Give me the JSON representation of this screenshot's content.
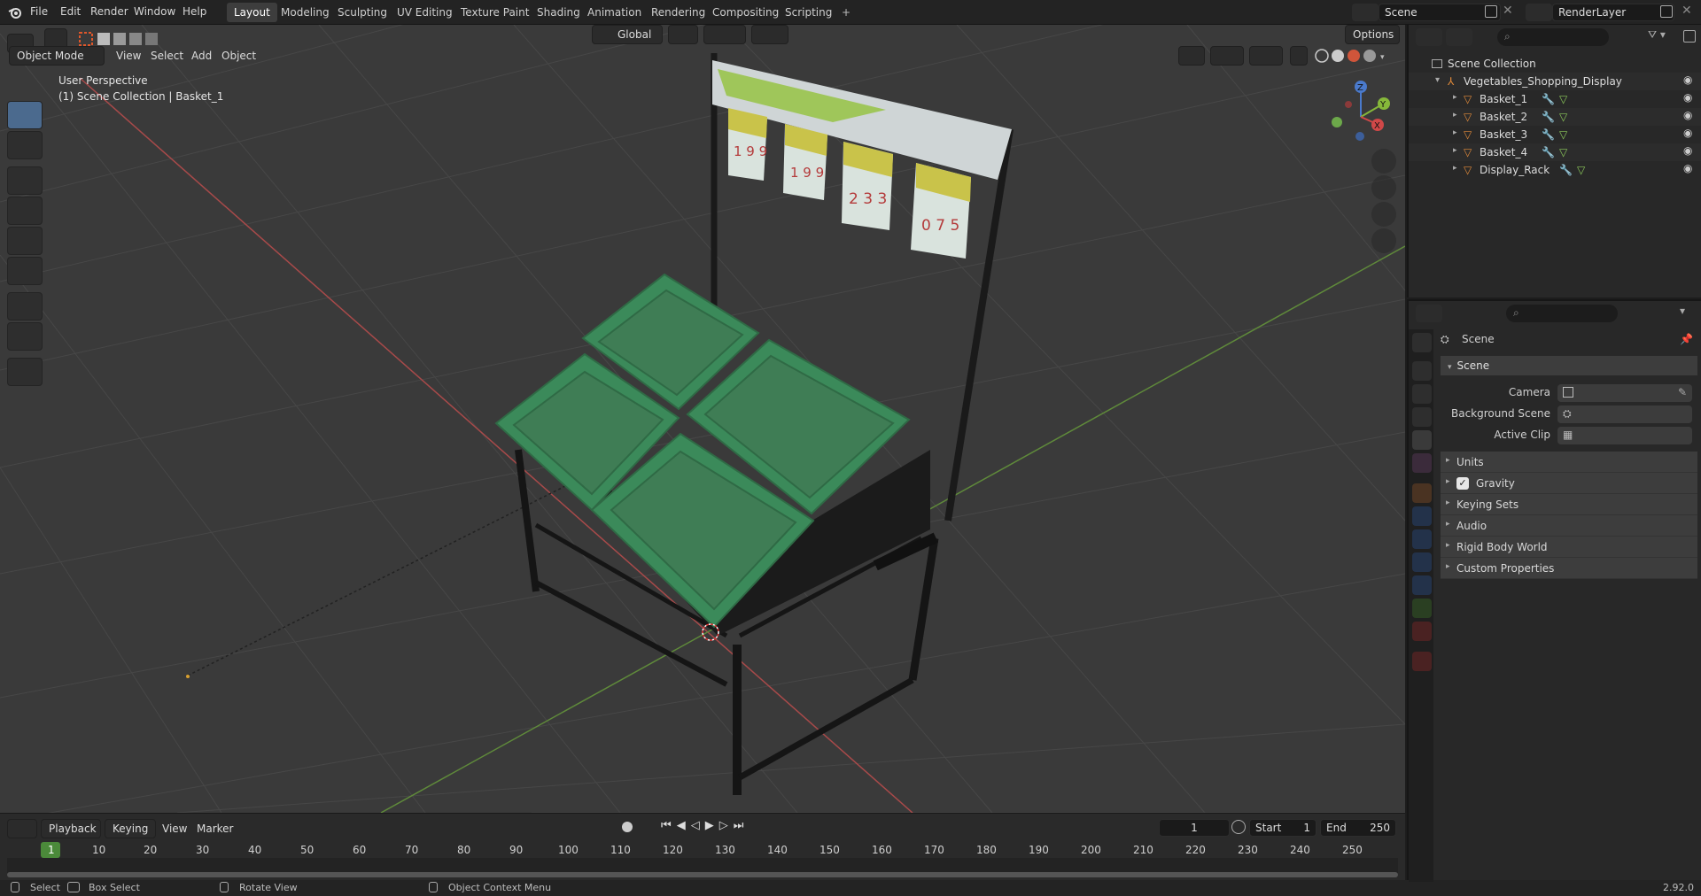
{
  "menu": [
    "File",
    "Edit",
    "Render",
    "Window",
    "Help"
  ],
  "workspaces": [
    "Layout",
    "Modeling",
    "Sculpting",
    "UV Editing",
    "Texture Paint",
    "Shading",
    "Animation",
    "Rendering",
    "Compositing",
    "Scripting"
  ],
  "active_workspace": "Layout",
  "add_tab": "+",
  "scene_name": "Scene",
  "view_layer": "RenderLayer",
  "viewport": {
    "mode": "Object Mode",
    "menus": [
      "View",
      "Select",
      "Add",
      "Object"
    ],
    "transform_orientation": "Global",
    "options_label": "Options",
    "info_line1": "User Perspective",
    "info_line2": "(1) Scene Collection | Basket_1",
    "gizmo": {
      "z": "Z",
      "y": "Y",
      "x": "X"
    },
    "sign_prices": [
      "1 9 9",
      "1 9 9",
      "2 3 3",
      "0 7 5"
    ]
  },
  "outliner": {
    "root": "Scene Collection",
    "collection": "Vegetables_Shopping_Display",
    "objects": [
      "Basket_1",
      "Basket_2",
      "Basket_3",
      "Basket_4",
      "Display_Rack"
    ]
  },
  "properties": {
    "context": "Scene",
    "panel": "Scene",
    "fields": {
      "camera": "Camera",
      "background_scene": "Background Scene",
      "active_clip": "Active Clip"
    },
    "subpanels": [
      "Units",
      "Gravity",
      "Keying Sets",
      "Audio",
      "Rigid Body World",
      "Custom Properties"
    ],
    "gravity_checked": true
  },
  "timeline": {
    "menus": [
      "Playback",
      "Keying",
      "View",
      "Marker"
    ],
    "current_frame": "1",
    "start_label": "Start",
    "start": "1",
    "end_label": "End",
    "end": "250",
    "ruler": [
      "1",
      "10",
      "20",
      "30",
      "40",
      "50",
      "60",
      "70",
      "80",
      "90",
      "100",
      "110",
      "120",
      "130",
      "140",
      "150",
      "160",
      "170",
      "180",
      "190",
      "200",
      "210",
      "220",
      "230",
      "240",
      "250"
    ]
  },
  "status": {
    "select": "Select",
    "box_select": "Box Select",
    "rotate_view": "Rotate View",
    "context_menu": "Object Context Menu",
    "version": "2.92.0"
  }
}
